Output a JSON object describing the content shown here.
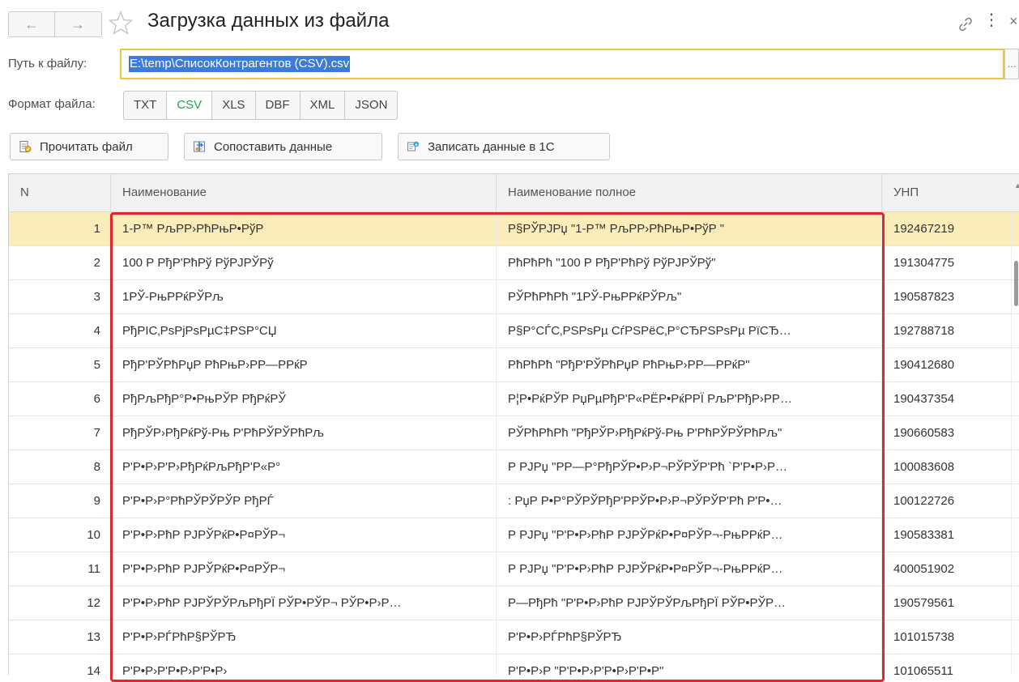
{
  "window": {
    "title": "Загрузка данных из файла",
    "back_glyph": "←",
    "forward_glyph": "→",
    "more_glyph": "⋮",
    "close_glyph": "×"
  },
  "path": {
    "label": "Путь к файлу:",
    "value": "E:\\temp\\СписокКонтрагентов (CSV).csv",
    "select_button": "..."
  },
  "format": {
    "label": "Формат файла:",
    "options": [
      "TXT",
      "CSV",
      "XLS",
      "DBF",
      "XML",
      "JSON"
    ],
    "selected": "CSV"
  },
  "toolbar": {
    "read_file": "Прочитать файл",
    "match_data": "Сопоставить данные",
    "write_data": "Записать данные в 1С"
  },
  "table": {
    "columns": [
      "N",
      "Наименование",
      "Наименование полное",
      "УНП"
    ],
    "selected_row": 1,
    "rows": [
      {
        "n": "1",
        "name": "1-Р™ РљРР›РћРњР•РўР",
        "full": "Р§РЎРЈРџ \"1-Р™ РљРР›РћРњР•РўР \"",
        "unp": "192467219"
      },
      {
        "n": "2",
        "name": "100 Р РђР'РћРў РўРЈРЎРў",
        "full": "РћРћРћ \"100 Р РђР'РћРў РўРЈРЎРў\"",
        "unp": "191304775"
      },
      {
        "n": "3",
        "name": "1РЎ-РњРРќРЎРљ",
        "full": "РЎРћРћРћ \"1РЎ-РњРРќРЎРљ\"",
        "unp": "190587823"
      },
      {
        "n": "4",
        "name": "РђРІС‚РѕРјРѕРµС‡РЅР°СЏ",
        "full": "Р§Р°СЃС‚РЅРѕРµ СѓРЅРёС‚Р°СЂРЅРѕРµ РїСЂ…",
        "unp": "192788718"
      },
      {
        "n": "5",
        "name": "РђР'РЎРћРџР РћРњР›РР—РРќР",
        "full": "РћРћРћ \"РђР'РЎРћРџР РћРњР›РР—РРќР\"",
        "unp": "190412680"
      },
      {
        "n": "6",
        "name": "РђРљРђР°Р•РњРЎР РђРќРЎ",
        "full": "Р¦Р•РќРЎР  РџРµРђР'Р«РЁР•РќРРЇ РљР'РђР›РР…",
        "unp": "190437354"
      },
      {
        "n": "7",
        "name": "РђРЎР›РђРќРў-Рњ Р'РћРЎРЎРћРљ",
        "full": "РЎРћРћРћ \"РђРЎР›РђРќРў-Рњ Р'РћРЎРЎРћРљ\"",
        "unp": "190660583"
      },
      {
        "n": "8",
        "name": "Р'Р•Р›Р'Р›РђРќРљРђР'Р«Р°",
        "full": "Р РЈРџ \"РР—Р°РђРЎР•Р›Р¬РЎРЎР'Рћ `Р'Р•Р›Р…",
        "unp": "100083608"
      },
      {
        "n": "9",
        "name": "Р'Р•Р›Р°РћРЎРЎРЎР РђРЃ",
        "full": ": РџР Р•Р°РЎРЎРђР'РРЎР•Р›Р¬РЎРЎР'Рћ Р'Р•…",
        "unp": "100122726"
      },
      {
        "n": "10",
        "name": "Р'Р•Р›РћР РЈРЎРќР•Р¤РЎР¬",
        "full": "Р РЈРџ \"Р'Р•Р›РћР РЈРЎРќР•Р¤РЎР¬-РњРРќР…",
        "unp": "190583381"
      },
      {
        "n": "11",
        "name": "Р'Р•Р›РћР РЈРЎРќР•Р¤РЎР¬",
        "full": "Р РЈРџ \"Р'Р•Р›РћР РЈРЎРќР•Р¤РЎР¬-РњРРќР…",
        "unp": "400051902"
      },
      {
        "n": "12",
        "name": "Р'Р•Р›РћР РЈРЎРЎРљРђРЇ РЎР•РЎР¬ РЎР•Р›Р…",
        "full": "Р—РђРћ \"Р'Р•Р›РћР РЈРЎРЎРљРђРЇ РЎР•РЎР…",
        "unp": "190579561"
      },
      {
        "n": "13",
        "name": "Р'Р•Р›РЃРћР§РЎРЂ",
        "full": "Р'Р•Р›РЃРћР§РЎРЂ",
        "unp": "101015738"
      },
      {
        "n": "14",
        "name": "Р'Р•Р›Р'Р•Р›Р'Р•Р›",
        "full": "Р'Р•Р›Р \"Р'Р•Р›Р'Р•Р›Р'Р•Р\"",
        "unp": "101065511"
      }
    ]
  }
}
